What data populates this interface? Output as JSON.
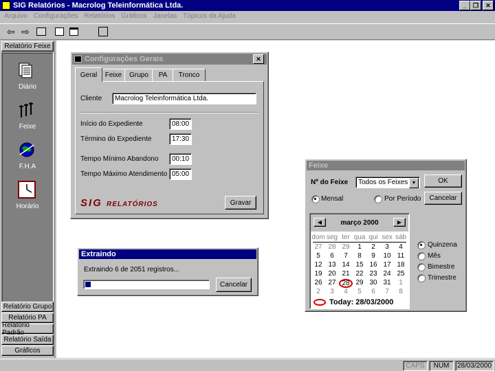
{
  "app": {
    "title": "SIG Relatórios - Macrolog Teleinformática Ltda.",
    "menu": [
      "Arquivo",
      "Configurações",
      "Relatórios",
      "Gráficos",
      "Janelas",
      "Tópicos da Ajuda"
    ]
  },
  "sidebar": {
    "header": "Relatório Feixe",
    "items": [
      {
        "label": "Diário",
        "icon": "daily-report-icon"
      },
      {
        "label": "Feixe",
        "icon": "trunk-lines-icon"
      },
      {
        "label": "F.H.A",
        "icon": "globe-icon"
      },
      {
        "label": "Horário",
        "icon": "clock-icon"
      }
    ],
    "bottom_buttons": [
      "Relatório Grupo",
      "Relatório PA",
      "Relatório Padrão",
      "Relatório Saída",
      "Gráficos"
    ]
  },
  "config_dialog": {
    "title": "Configurações Gerais",
    "tabs": [
      "Geral",
      "Feixe",
      "Grupo",
      "PA",
      "Tronco"
    ],
    "cliente_label": "Cliente",
    "cliente_value": "Macrolog Teleinformática Ltda.",
    "fields": [
      {
        "label": "Início do Expediente",
        "value": "08:00"
      },
      {
        "label": "Término do Expediente",
        "value": "17:30"
      },
      {
        "label": "Tempo Mínimo Abandono",
        "value": "00:10"
      },
      {
        "label": "Tempo Máximo Atendimento",
        "value": "05:00"
      }
    ],
    "logo_sig": "SIG",
    "logo_rel": "RELATÓRIOS",
    "save_button": "Gravar"
  },
  "extract_dialog": {
    "title": "Extraindo",
    "message": "Extraindo 6 de 2051 registros...",
    "progress": 0.03,
    "cancel_button": "Cancelar"
  },
  "feixe_dialog": {
    "title": "Feixe",
    "no_feixe_label": "Nº do Feixe",
    "no_feixe_value": "Todos os Feixes",
    "ok_button": "OK",
    "cancel_button": "Cancelar",
    "mode_options": [
      {
        "label": "Mensal",
        "checked": true
      },
      {
        "label": "Por Período",
        "checked": false
      }
    ],
    "period_options": [
      {
        "label": "Quinzena",
        "checked": true
      },
      {
        "label": "Mês",
        "checked": false
      },
      {
        "label": "Bimestre",
        "checked": false
      },
      {
        "label": "Trimestre",
        "checked": false
      }
    ],
    "calendar": {
      "month_label": "março 2000",
      "weekdays": [
        "dom",
        "seg",
        "ter",
        "qua",
        "qui",
        "sex",
        "sáb"
      ],
      "rows": [
        [
          "27",
          "28",
          "29",
          "1",
          "2",
          "3",
          "4"
        ],
        [
          "5",
          "6",
          "7",
          "8",
          "9",
          "10",
          "11"
        ],
        [
          "12",
          "13",
          "14",
          "15",
          "16",
          "17",
          "18"
        ],
        [
          "19",
          "20",
          "21",
          "22",
          "23",
          "24",
          "25"
        ],
        [
          "26",
          "27",
          "28",
          "29",
          "30",
          "31",
          "1"
        ],
        [
          "2",
          "3",
          "4",
          "5",
          "6",
          "7",
          "8"
        ]
      ],
      "today_label": "Today: 28/03/2000"
    }
  },
  "statusbar": {
    "caps": "CAPS",
    "num": "NUM",
    "date": "28/03/2000"
  }
}
